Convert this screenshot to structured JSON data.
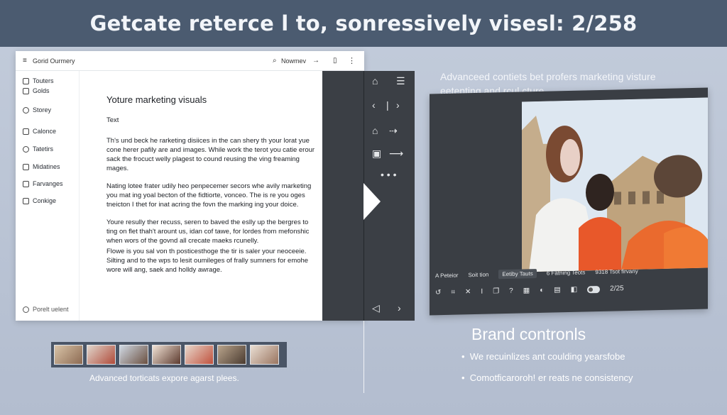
{
  "banner": {
    "title": "Getcate reterce l to, sonressively visesl: 2/258"
  },
  "editor": {
    "topbar": {
      "title": "Gorid Ourmery",
      "search_label": "Nowmev"
    },
    "sidebar": {
      "items": [
        {
          "label": "Touters"
        },
        {
          "label": "Golds"
        },
        {
          "label": "Storey"
        },
        {
          "label": "Calonce"
        },
        {
          "label": "Tatetirs"
        },
        {
          "label": "Midatines"
        },
        {
          "label": "Farvanges"
        },
        {
          "label": "Conkige"
        }
      ],
      "footer": "Porelt uelent"
    },
    "doc": {
      "heading": "Yoture marketing visuals",
      "label": "Text",
      "paragraphs": [
        "Th's und beck he rarketing disiices in the can shery th your lorat yue cone herer pafily are and images. While work the terot you catie erour sack the frocuct welly plagest to cound reusing the ving freaming mages.",
        "Nating lotee frater udily heo penpecemer secors whe avily marketing you mat ing yoal becton of the fidtiorte, vonceo. The is re you oges tneicton I thet for inat acring the fovn the marking ing your doice.",
        "Youre resully ther recuss, seren to baved the eslly up the bergres to ting on flet thah't arount us, idan cof tawe, for lordes from mefonshic when wors of the govnd all crecate maeks rcunelly.",
        "Flowe is you sal von th posticesthoge the tir is saler your neoceeie. Silting and to the wps to lesit oumileges of frally sumners for emohe wore will ang, saek and holldy awrage."
      ]
    }
  },
  "preview": {
    "intro": "Advanceed contiets bet profers marketing visture eetenting and rcul cture.",
    "toolbar1": {
      "a": "A Peteior",
      "b": "Soit tion",
      "c": "Eetiby Tauts",
      "d": "6 Fatning Teots",
      "e": "9318 Tsot firvany"
    },
    "toolbar2": {
      "count": "2/25"
    }
  },
  "brand": {
    "title": "Brand contronls",
    "bullets": [
      "We recuinlizes ant coulding yearsfobe",
      "Comotficaroroh! er reats ne consistency"
    ]
  },
  "filmstrip": {
    "caption": "Advanced torticats expore agarst plees."
  },
  "colors": {
    "banner": "#4b5b70",
    "toolstrip": "#3b3f45",
    "background": "#c3ccdb",
    "accent_green": "#4fc24f"
  }
}
